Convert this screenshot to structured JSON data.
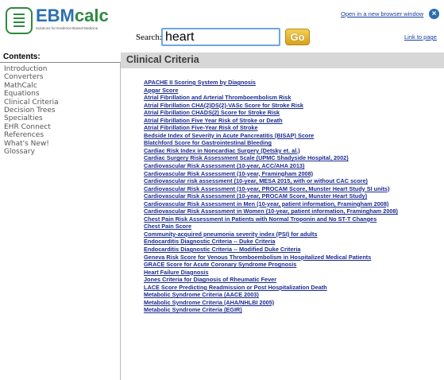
{
  "header": {
    "logo_text_ebm": "EBM",
    "logo_text_calc": "calc",
    "logo_tagline": "Solutions for Evidence-Based Medicine",
    "open_new_window": "Open in a new browser window",
    "close_label": "×",
    "search_label": "Search:",
    "search_value": "heart",
    "go_label": "Go",
    "link_to_page": "Link to page"
  },
  "sidebar": {
    "heading": "Contents:",
    "items": [
      "Introduction",
      "Converters",
      "MathCalc",
      "Equations",
      "Clinical Criteria",
      "Decision Trees",
      "Specialties",
      "EHR Connect",
      "References",
      "What's New!",
      "Glossary"
    ]
  },
  "main": {
    "title": "Clinical Criteria",
    "links": [
      "APACHE II Scoring System by Diagnosis",
      "Apgar Score",
      "Atrial Fibrillation and Arterial Thromboembolism Risk",
      "Atrial Fibrillation CHA(2)DS(2)-VASc Score for Stroke Risk",
      "Atrial Fibrillation CHADS(2) Score for Stroke Risk",
      "Atrial Fibrillation Five Year Risk of Stroke or Death",
      "Atrial Fibrillation Five-Year Risk of Stroke",
      "Bedside Index of Severity in Acute Pancreatitis (BISAP) Score",
      "Blatchford Score for Gastrointestinal Bleeding",
      "Cardiac Risk Index in Noncardiac Surgery (Detsky et. al.)",
      "Cardiac Surgery Risk Assessment Scale (UPMC Shadyside Hospital, 2002)",
      "Cardiovascular Risk Assessment (10-year, ACC/AHA 2013)",
      "Cardiovascular Risk Assessment (10-year, Framingham 2008)",
      "Cardiovascular risk assessment (10-year, MESA 2015, with or without CAC score)",
      "Cardiovascular Risk Assessment (10-year, PROCAM Score, Munster Heart Study SI units)",
      "Cardiovascular Risk Assessment (10-year, PROCAM Score, Munster Heart Study)",
      "Cardiovascular Risk Assessment in Men (10-year, patient information, Framingham 2008)",
      "Cardiovascular Risk Assessment in Women (10-year, patient information, Framingham 2008)",
      "Chest Pain Risk Assessment in Patients with Normal Troponin and No ST-T Changes",
      "Chest Pain Score",
      "Community-acquired pneumonia severity index (PSI) for adults",
      "Endocarditis Diagnostic Criteria -- Duke Criteria",
      "Endocarditis Diagnostic Criteria -- Modified Duke Criteria",
      "Geneva Risk Score for Venous Thromboembolism in Hospitalized Medical Patients",
      "GRACE Score for Acute Coronary Syndrome Prognosis",
      "Heart Failure Diagnosis",
      "Jones Criteria for Diagnosis of Rheumatic Fever",
      "LACE Score Predicting Readmission or Post Hospitalization Death",
      "Metabolic Syndrome Criteria (AACE 2003)",
      "Metabolic Syndrome Criteria (AHA/NHLBI 2005)",
      "Metabolic Syndrome Criteria (EGIR)"
    ]
  },
  "colors": {
    "brand_blue": "#2b6fb2",
    "brand_green": "#2e8a3e",
    "link": "#1b2c8f",
    "title_bar": "#d7d7d7",
    "go_button": "#e2b232"
  }
}
